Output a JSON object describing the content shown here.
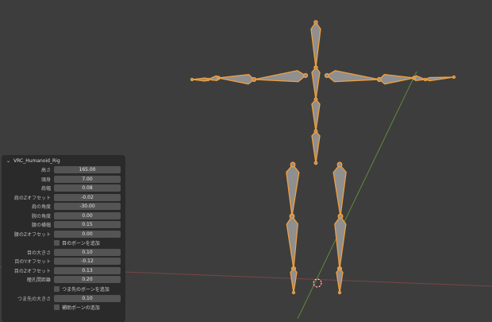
{
  "panel": {
    "title": "VRC_Humanoid_Rig",
    "rows": [
      {
        "type": "field",
        "label": "高さ",
        "value": "165.00"
      },
      {
        "type": "field",
        "label": "頭身",
        "value": "7.00"
      },
      {
        "type": "field",
        "label": "肩幅",
        "value": "0.08"
      },
      {
        "type": "field",
        "label": "肩のZオフセット",
        "value": "-0.02"
      },
      {
        "type": "field",
        "label": "肩の角度",
        "value": "-30.00"
      },
      {
        "type": "field",
        "label": "腕の角度",
        "value": "0.00"
      },
      {
        "type": "field",
        "label": "腰の横幅",
        "value": "0.15"
      },
      {
        "type": "field",
        "label": "腰のZオフセット",
        "value": "0.00"
      },
      {
        "type": "check",
        "label": "目のボーンを追加"
      },
      {
        "type": "field",
        "label": "目の大きさ",
        "value": "0.10"
      },
      {
        "type": "field",
        "label": "目のYオフセット",
        "value": "-0.12"
      },
      {
        "type": "field",
        "label": "目のZオフセット",
        "value": "0.13"
      },
      {
        "type": "field",
        "label": "瞳孔間距離",
        "value": "0.20"
      },
      {
        "type": "check",
        "label": "つま先のボーンを追加"
      },
      {
        "type": "field",
        "label": "つま先の大きさ",
        "value": "0.10"
      },
      {
        "type": "check",
        "label": "補助ボーンの追加"
      }
    ]
  },
  "colors": {
    "bone": "#8f8f8f",
    "outline": "#f0a040",
    "x_axis": "#8a4a4a",
    "y_axis": "#6a9a3a"
  }
}
